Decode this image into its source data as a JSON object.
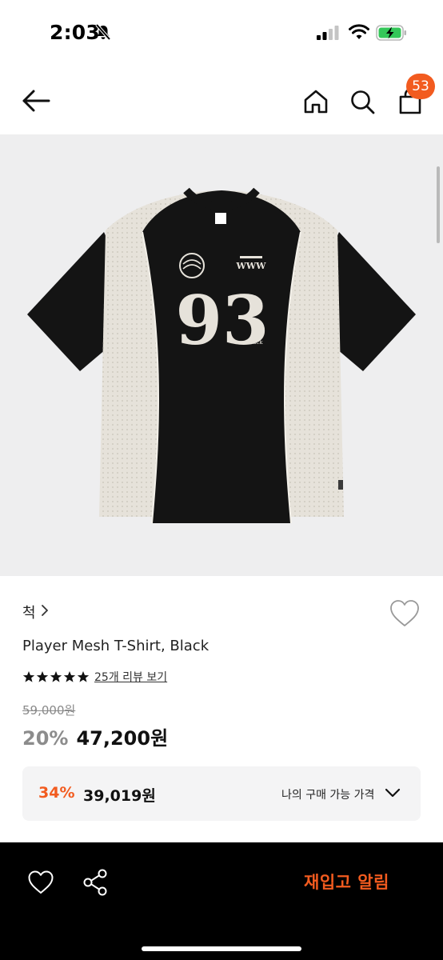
{
  "status_bar": {
    "time": "2:03"
  },
  "header": {
    "cart_count": "53",
    "icons": [
      "back-arrow-icon",
      "home-icon",
      "search-icon",
      "shopping-bag-icon"
    ]
  },
  "product": {
    "brand": "척",
    "title": "Player Mesh T-Shirt, Black",
    "rating_stars": 5,
    "review_link": "25개 리뷰 보기",
    "original_price": "59,000원",
    "discount_rate": "20%",
    "sale_price": "47,200원",
    "shirt_number": "93",
    "shirt_text": "WWW",
    "shirt_sub_text": "Chuck"
  },
  "member_price": {
    "rate": "34%",
    "price": "39,019원",
    "label": "나의 구매 가능 가격"
  },
  "bottom_bar": {
    "restock_label": "재입고 알림"
  },
  "colors": {
    "accent": "#f25b1f",
    "bottom_bar_bg": "#000000",
    "image_bg": "#eeeeef"
  }
}
